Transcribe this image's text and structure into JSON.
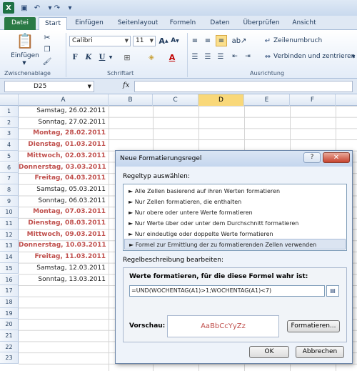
{
  "window": {
    "quick_access": [
      "save-icon",
      "undo-icon",
      "redo-icon",
      "customize-icon"
    ]
  },
  "tabs": [
    {
      "label": "Datei"
    },
    {
      "label": "Start"
    },
    {
      "label": "Einfügen"
    },
    {
      "label": "Seitenlayout"
    },
    {
      "label": "Formeln"
    },
    {
      "label": "Daten"
    },
    {
      "label": "Überprüfen"
    },
    {
      "label": "Ansicht"
    }
  ],
  "ribbon": {
    "clipboard": {
      "paste_label": "Einfügen",
      "group_label": "Zwischenablage"
    },
    "font": {
      "font_name": "Calibri",
      "font_size": "11",
      "bold": "F",
      "italic": "K",
      "underline": "U",
      "group_label": "Schriftart"
    },
    "alignment": {
      "wrap_label": "Zeilenumbruch",
      "merge_label": "Verbinden und zentrieren",
      "group_label": "Ausrichtung"
    }
  },
  "formula_bar": {
    "name_box": "D25",
    "fx": "fx",
    "formula": ""
  },
  "columns": [
    "A",
    "B",
    "C",
    "D",
    "E",
    "F"
  ],
  "active_column": "D",
  "rows": [
    "1",
    "2",
    "3",
    "4",
    "5",
    "6",
    "7",
    "8",
    "9",
    "10",
    "11",
    "12",
    "13",
    "14",
    "15",
    "16",
    "17",
    "18",
    "19",
    "20",
    "21",
    "22",
    "23"
  ],
  "cells_a": [
    {
      "text": "Samstag, 26.02.2011",
      "highlight": false
    },
    {
      "text": "Sonntag, 27.02.2011",
      "highlight": false
    },
    {
      "text": "Montag, 28.02.2011",
      "highlight": true
    },
    {
      "text": "Dienstag, 01.03.2011",
      "highlight": true
    },
    {
      "text": "Mittwoch, 02.03.2011",
      "highlight": true
    },
    {
      "text": "Donnerstag, 03.03.2011",
      "highlight": true
    },
    {
      "text": "Freitag, 04.03.2011",
      "highlight": true
    },
    {
      "text": "Samstag, 05.03.2011",
      "highlight": false
    },
    {
      "text": "Sonntag, 06.03.2011",
      "highlight": false
    },
    {
      "text": "Montag, 07.03.2011",
      "highlight": true
    },
    {
      "text": "Dienstag, 08.03.2011",
      "highlight": true
    },
    {
      "text": "Mittwoch, 09.03.2011",
      "highlight": true
    },
    {
      "text": "Donnerstag, 10.03.2011",
      "highlight": true
    },
    {
      "text": "Freitag, 11.03.2011",
      "highlight": true
    },
    {
      "text": "Samstag, 12.03.2011",
      "highlight": false
    },
    {
      "text": "Sonntag, 13.03.2011",
      "highlight": false
    }
  ],
  "highlight_color": "#c0504d",
  "dialog": {
    "title": "Neue Formatierungsregel",
    "help": "?",
    "close": "✕",
    "rule_type_label": "Regeltyp auswählen:",
    "rule_types": [
      "► Alle Zellen basierend auf ihren Werten formatieren",
      "► Nur Zellen formatieren, die enthalten",
      "► Nur obere oder untere Werte formatieren",
      "► Nur Werte über oder unter dem Durchschnitt formatieren",
      "► Nur eindeutige oder doppelte Werte formatieren",
      "► Formel zur Ermittlung der zu formatierenden Zellen verwenden"
    ],
    "selected_rule_index": 5,
    "description_label": "Regelbeschreibung bearbeiten:",
    "formula_heading": "Werte formatieren, für die diese Formel wahr ist:",
    "formula": "=UND(WOCHENTAG(A1)>1;WOCHENTAG(A1)<7)",
    "preview_label": "Vorschau:",
    "preview_text": "AaBbCcYyZz",
    "format_button": "Formatieren...",
    "ok_button": "OK",
    "cancel_button": "Abbrechen"
  }
}
